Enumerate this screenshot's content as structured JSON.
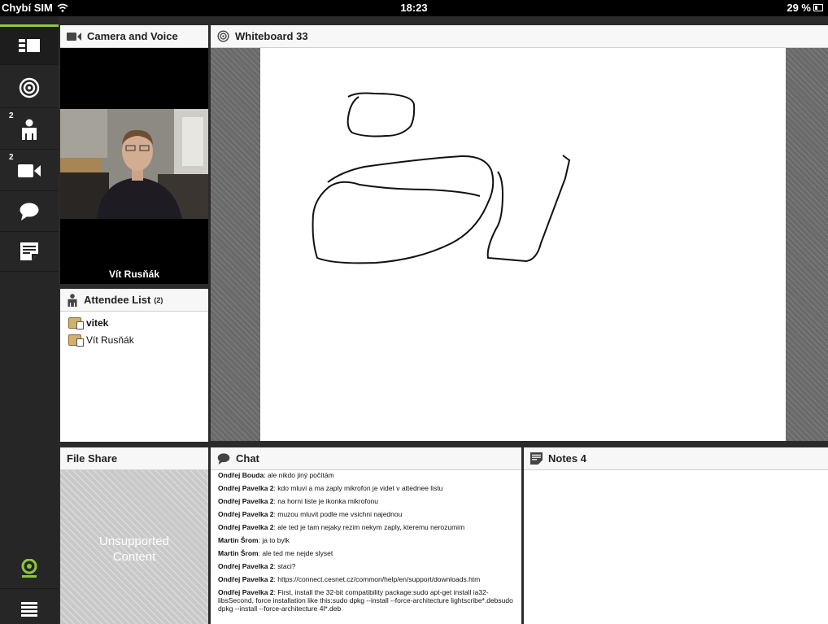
{
  "status_bar": {
    "carrier": "Chybí SIM",
    "time": "18:23",
    "battery": "29 %"
  },
  "sidebar": {
    "items": [
      {
        "icon": "layout-icon",
        "badge": ""
      },
      {
        "icon": "whiteboard-target-icon",
        "badge": ""
      },
      {
        "icon": "attendee-icon",
        "badge": "2"
      },
      {
        "icon": "video-camera-icon",
        "badge": "2"
      },
      {
        "icon": "chat-bubble-icon",
        "badge": ""
      },
      {
        "icon": "notes-icon",
        "badge": ""
      }
    ],
    "bottom_items": [
      {
        "icon": "webcam-icon"
      },
      {
        "icon": "menu-icon"
      }
    ],
    "accent": "#8cc63f"
  },
  "camera_panel": {
    "title": "Camera and Voice",
    "speaker_name": "Vít Rusňák"
  },
  "attendee_panel": {
    "title": "Attendee List",
    "count": "(2)",
    "attendees": [
      {
        "name": "vitek",
        "bold": true
      },
      {
        "name": "Vít Rusňák",
        "bold": false
      }
    ]
  },
  "whiteboard_panel": {
    "title": "Whiteboard 33"
  },
  "fileshare_panel": {
    "title": "File Share",
    "message_line1": "Unsupported",
    "message_line2": "Content"
  },
  "chat_panel": {
    "title": "Chat",
    "messages": [
      {
        "author": "Ondřej Bouda",
        "sep": ":",
        "text": " ale nikdo jiný počítám"
      },
      {
        "author": "Ondřej Pavelka 2",
        "sep": ":",
        "text": " kdo mluvi a ma zaply mikrofon je videt v attednee listu"
      },
      {
        "author": "Ondřej Pavelka 2",
        "sep": ":",
        "text": " na horni liste je ikonka mikrofonu"
      },
      {
        "author": "Ondřej Pavelka 2",
        "sep": ":",
        "text": " muzou mluvit podle me vsichni najednou"
      },
      {
        "author": "Ondřej Pavelka 2",
        "sep": ":",
        "text": " ale ted je tam nejaky rezim nekym zaply, kteremu nerozumim"
      },
      {
        "author": "Martin Šrom",
        "sep": ":",
        "text": " ja to bylk"
      },
      {
        "author": "Martin Šrom",
        "sep": ":",
        "text": " ale ted me nejde slyset"
      },
      {
        "author": "Ondřej Pavelka 2",
        "sep": ":",
        "text": " staci?"
      },
      {
        "author": "Ondřej Pavelka 2",
        "sep": ":",
        "text": " https://connect.cesnet.cz/common/help/en/support/downloads.htm"
      },
      {
        "author": "Ondřej Pavelka 2",
        "sep": ":",
        "text": " First, install the 32-bit compatibility package:sudo apt-get install ia32-libsSecond, force installation like this:sudo dpkg --install --force-architecture lightscribe*.debsudo dpkg --install --force-architecture 4l*.deb"
      }
    ]
  },
  "notes_panel": {
    "title": "Notes 4"
  }
}
